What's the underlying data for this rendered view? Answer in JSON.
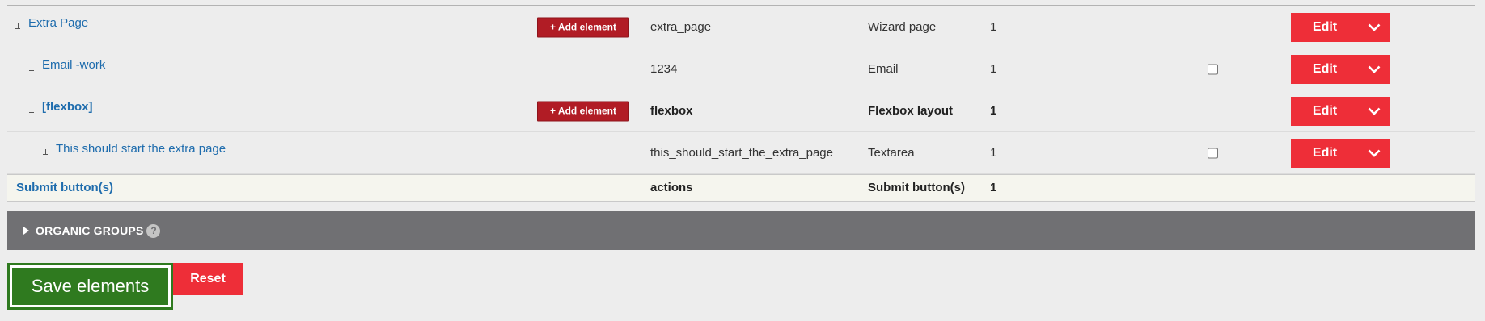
{
  "rows": [
    {
      "title": "Extra Page",
      "add_element_label": "+ Add element",
      "key": "extra_page",
      "type": "Wizard page",
      "weight": "1",
      "edit_label": "Edit"
    },
    {
      "title": "Email -work",
      "key": "1234",
      "type": "Email",
      "weight": "1",
      "required_checked": false,
      "edit_label": "Edit"
    },
    {
      "title": "[flexbox]",
      "add_element_label": "+ Add element",
      "key": "flexbox",
      "type": "Flexbox layout",
      "weight": "1",
      "edit_label": "Edit"
    },
    {
      "title": "This should start the extra page",
      "key": "this_should_start_the_extra_page",
      "type": "Textarea",
      "weight": "1",
      "required_checked": false,
      "edit_label": "Edit"
    }
  ],
  "submit_row": {
    "title": "Submit button(s)",
    "key": "actions",
    "type": "Submit button(s)",
    "weight": "1"
  },
  "organic_groups": {
    "label": "ORGANIC GROUPS",
    "help_glyph": "?"
  },
  "actions": {
    "save_label": "Save elements",
    "reset_label": "Reset"
  },
  "icons": {
    "drag": "drag-handle-icon",
    "dropdown": "chevron-down-icon",
    "disclosure": "triangle-right-icon",
    "help": "help-icon"
  },
  "colors": {
    "link": "#1e6cad",
    "add_element_bg": "#b11c25",
    "edit_bg": "#ee2e38",
    "save_bg": "#2f7a1f",
    "organic_bar_bg": "#707073"
  }
}
